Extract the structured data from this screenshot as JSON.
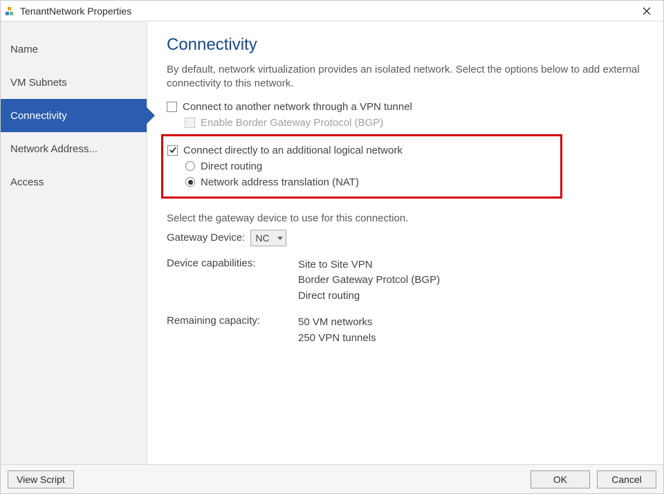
{
  "window": {
    "title": "TenantNetwork Properties"
  },
  "sidebar": {
    "items": [
      {
        "label": "Name"
      },
      {
        "label": "VM Subnets"
      },
      {
        "label": "Connectivity",
        "selected": true
      },
      {
        "label": "Network Address..."
      },
      {
        "label": "Access"
      }
    ]
  },
  "main": {
    "heading": "Connectivity",
    "description": "By default, network virtualization provides an isolated network. Select the options below to add external connectivity to this network.",
    "vpn_checkbox": {
      "label": "Connect to another network through a VPN tunnel",
      "checked": false
    },
    "bgp_checkbox": {
      "label": "Enable Border Gateway Protocol (BGP)",
      "checked": false,
      "disabled": true
    },
    "direct_checkbox": {
      "label": "Connect directly to an additional logical network",
      "checked": true
    },
    "routing_radio": {
      "options": [
        {
          "label": "Direct routing",
          "selected": false
        },
        {
          "label": "Network address translation (NAT)",
          "selected": true
        }
      ]
    },
    "gateway_prompt": "Select the gateway device to use for this connection.",
    "gateway_label": "Gateway Device:",
    "gateway_value": "NC",
    "capabilities_label": "Device capabilities:",
    "capabilities": [
      "Site to Site VPN",
      "Border Gateway Protcol (BGP)",
      "Direct routing"
    ],
    "capacity_label": "Remaining capacity:",
    "capacity": [
      "50 VM networks",
      "250 VPN tunnels"
    ]
  },
  "footer": {
    "view_script": "View Script",
    "ok": "OK",
    "cancel": "Cancel"
  }
}
